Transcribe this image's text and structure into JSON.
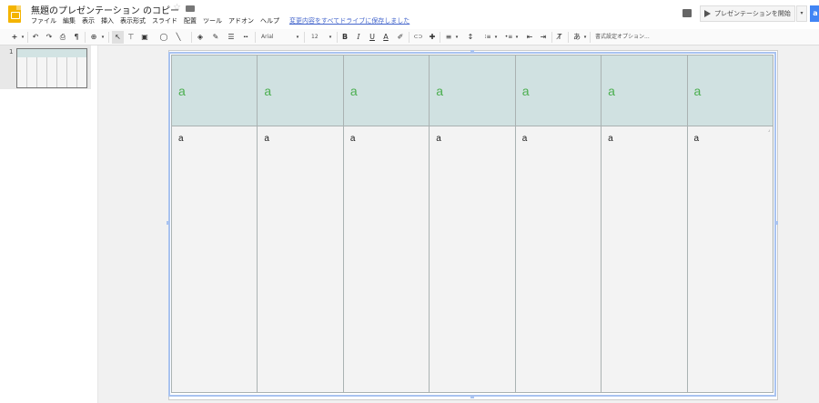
{
  "titlebar": {
    "title": "無題のプレゼンテーション のコピー",
    "star": "☆",
    "save_status": "変更内容をすべてドライブに保存しました",
    "present_label": "プレゼンテーションを開始",
    "present_dropdown": "▾",
    "share_label": "a"
  },
  "menu": [
    "ファイル",
    "編集",
    "表示",
    "挿入",
    "表示形式",
    "スライド",
    "配置",
    "ツール",
    "アドオン",
    "ヘルプ"
  ],
  "toolbar": {
    "new_slide": "+",
    "undo": "↶",
    "redo": "↷",
    "print": "⎙",
    "paint": "¶",
    "zoom": "⊕",
    "select": "↖",
    "font": "Arial",
    "font_size": "12",
    "bold": "B",
    "italic": "I",
    "underline": "U",
    "text_color": "A",
    "link": "⊂⊃",
    "comment": "✚",
    "align": "≡",
    "line_spacing": "↕",
    "numbered": "⁝≡",
    "bulleted": "•≡",
    "indent_dec": "⇤",
    "indent_inc": "⇥",
    "clear_format": "T̸",
    "input_tools": "あ",
    "format_options": "書式設定オプション..."
  },
  "filmstrip": {
    "slide_number": "1"
  },
  "table": {
    "header_cells": [
      "a",
      "a",
      "a",
      "a",
      "a",
      "a",
      "a"
    ],
    "body_cells": [
      "a",
      "a",
      "a",
      "a",
      "a",
      "a",
      "a"
    ],
    "header_bg": "#d0e1e1",
    "header_text_color": "#4caf50"
  },
  "colors": {
    "selection": "#a9c3f0",
    "logo": "#f4b400",
    "share": "#4285f4"
  }
}
